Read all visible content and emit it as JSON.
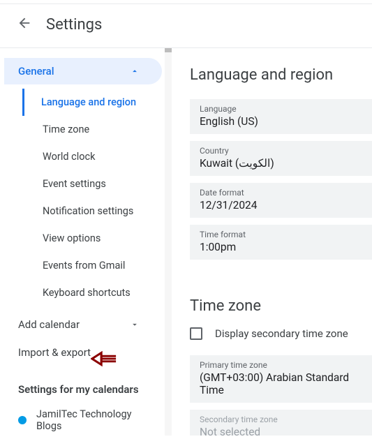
{
  "header": {
    "title": "Settings"
  },
  "sidebar": {
    "general": {
      "label": "General",
      "items": [
        "Language and region",
        "Time zone",
        "World clock",
        "Event settings",
        "Notification settings",
        "View options",
        "Events from Gmail",
        "Keyboard shortcuts"
      ],
      "activeIndex": 0
    },
    "addCalendar": "Add calendar",
    "importExport": "Import & export",
    "myCalendarsHeading": "Settings for my calendars",
    "calendars": [
      {
        "name": "JamilTec Technology Blogs",
        "color": "#039be5"
      }
    ]
  },
  "main": {
    "langRegion": {
      "title": "Language and region",
      "fields": {
        "language": {
          "label": "Language",
          "value": "English (US)"
        },
        "country": {
          "label": "Country",
          "value": "Kuwait (الكويت)"
        },
        "dateFormat": {
          "label": "Date format",
          "value": "12/31/2024"
        },
        "timeFormat": {
          "label": "Time format",
          "value": "1:00pm"
        }
      }
    },
    "timeZone": {
      "title": "Time zone",
      "secondaryCheckboxLabel": "Display secondary time zone",
      "primary": {
        "label": "Primary time zone",
        "value": "(GMT+03:00) Arabian Standard Time"
      },
      "secondary": {
        "label": "Secondary time zone",
        "value": "Not selected"
      }
    }
  }
}
